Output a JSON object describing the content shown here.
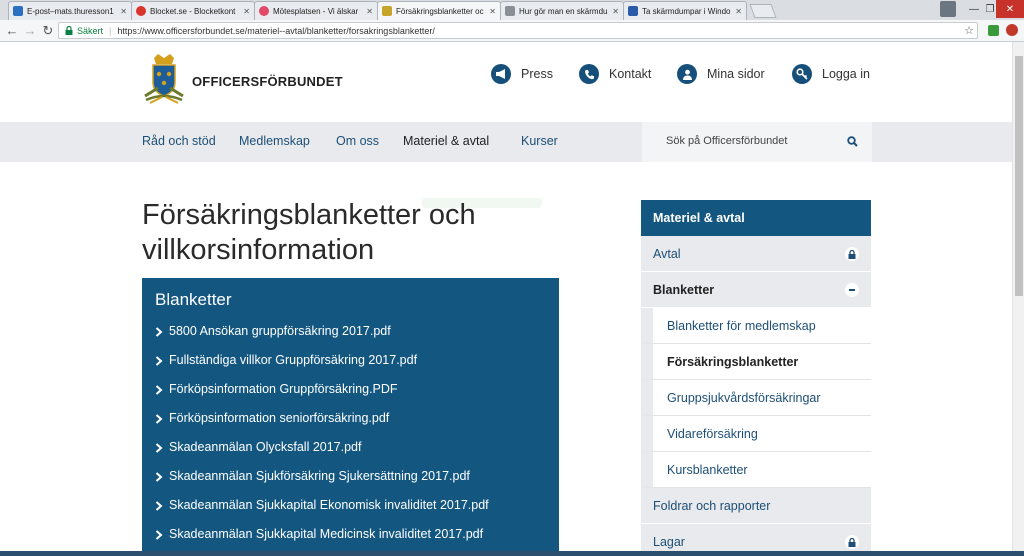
{
  "browser": {
    "tabs": [
      {
        "title": "E-post–mats.thuresson1",
        "color": "#2a6fc0"
      },
      {
        "title": "Blocket.se - Blocketkont",
        "color": "#d9342b"
      },
      {
        "title": "Mötesplatsen - Vi älskar",
        "color": "#e24a6a"
      },
      {
        "title": "Försäkringsblanketter oc",
        "color": "#c7a52a"
      },
      {
        "title": "Hur gör man en skärmdu",
        "color": "#8a8f96"
      },
      {
        "title": "Ta skärmdumpar i Windo",
        "color": "#2b5aa8"
      }
    ],
    "secure_label": "Säkert",
    "url": "https://www.officersforbundet.se/materiel--avtal/blanketter/forsakringsblanketter/"
  },
  "header": {
    "brand": "OFFICERSFÖRBUNDET",
    "top_links": [
      "Press",
      "Kontakt",
      "Mina sidor",
      "Logga in"
    ],
    "top_icons": [
      "megaphone-icon",
      "phone-icon",
      "user-icon",
      "key-icon"
    ]
  },
  "nav": {
    "items": [
      "Råd och stöd",
      "Medlemskap",
      "Om oss",
      "Materiel & avtal",
      "Kurser"
    ],
    "active": "Materiel & avtal",
    "search_placeholder": "Sök på Officersförbundet"
  },
  "page": {
    "title": "Försäkringsblanketter och villkorsinformation"
  },
  "blanketter": {
    "heading": "Blanketter",
    "files": [
      "5800 Ansökan gruppförsäkring 2017.pdf",
      "Fullständiga villkor Gruppförsäkring 2017.pdf",
      "Förköpsinformation Gruppförsäkring.PDF",
      "Förköpsinformation seniorförsäkring.pdf",
      "Skadeanmälan Olycksfall 2017.pdf",
      "Skadeanmälan Sjukförsäkring Sjukersättning 2017.pdf",
      "Skadeanmälan Sjukkapital Ekonomisk invaliditet 2017.pdf",
      "Skadeanmälan Sjukkapital Medicinsk invaliditet 2017.pdf"
    ]
  },
  "sidebar": {
    "heading": "Materiel & avtal",
    "avtal": "Avtal",
    "blanketter": "Blanketter",
    "sub": [
      "Blanketter för medlemskap",
      "Försäkringsblanketter",
      "Gruppsjukvårdsförsäkringar",
      "Vidareförsäkring",
      "Kursblanketter"
    ],
    "foldrar": "Foldrar och rapporter",
    "lagar": "Lagar"
  }
}
